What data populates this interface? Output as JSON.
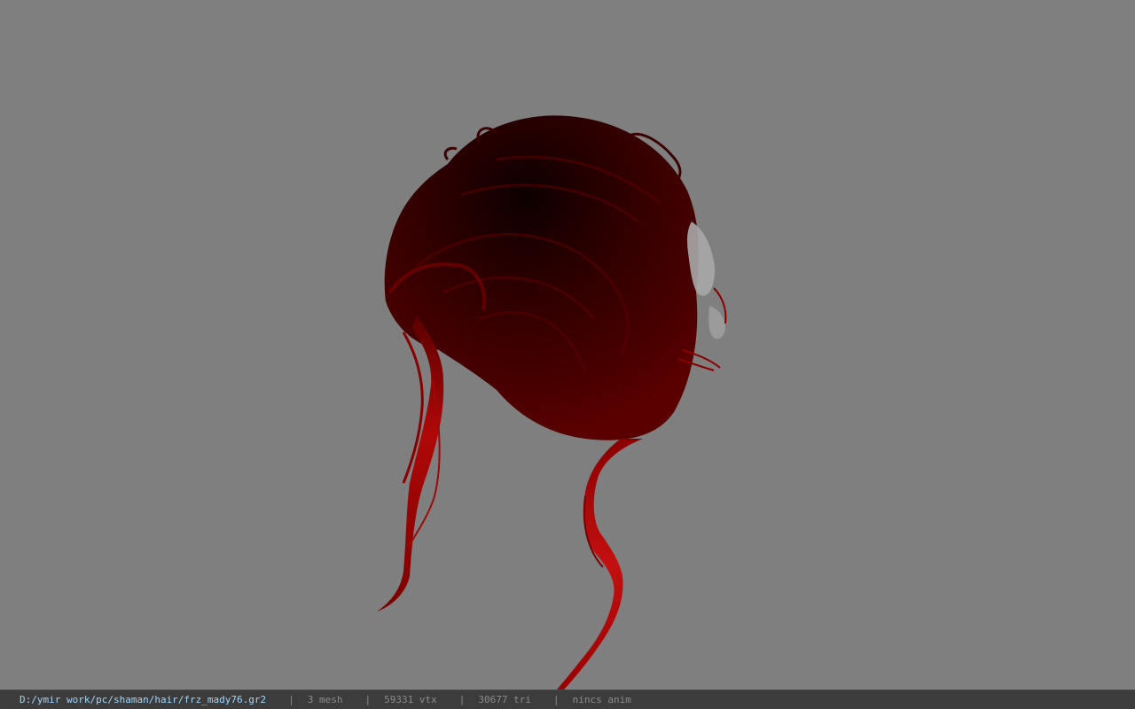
{
  "viewport": {
    "background_color": "#7f7f7f",
    "model_colors": {
      "hair_dark": "#2a0000",
      "hair_mid": "#4d0000",
      "hair_bright": "#a00000",
      "hair_highlight": "#c41010",
      "accessory": "#a8a8a8"
    }
  },
  "statusbar": {
    "file_path": "D:/ymir work/pc/shaman/hair/frz_mady76.gr2",
    "separator": "|",
    "mesh_count": "3 mesh",
    "vertex_count": "59331 vtx",
    "triangle_count": "30677 tri",
    "animation_status": "nincs anim",
    "colors": {
      "background": "#3c3c3c",
      "path_text": "#9fd8ff",
      "info_text": "#8c8c8c"
    }
  }
}
